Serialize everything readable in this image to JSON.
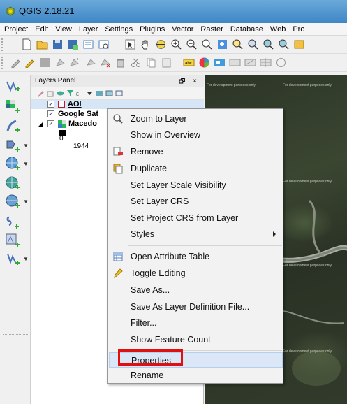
{
  "window": {
    "title": "QGIS 2.18.21"
  },
  "menubar": {
    "items": [
      "Project",
      "Edit",
      "View",
      "Layer",
      "Settings",
      "Plugins",
      "Vector",
      "Raster",
      "Database",
      "Web",
      "Pro"
    ]
  },
  "layers_panel": {
    "title": "Layers Panel",
    "controls": "🗗 ×",
    "layers": [
      {
        "name": "AOI",
        "checked": true
      },
      {
        "name": "Google Sat",
        "checked": true
      },
      {
        "name": "Macedo",
        "checked": true
      }
    ],
    "legend": {
      "value_a": "0",
      "value_b": "1944"
    }
  },
  "map": {
    "watermark": "For development purposes only"
  },
  "context_menu": {
    "items": [
      {
        "label": "Zoom to Layer",
        "icon": "zoom-icon"
      },
      {
        "label": "Show in Overview",
        "icon": ""
      },
      {
        "label": "Remove",
        "icon": "remove-layer-icon"
      },
      {
        "label": "Duplicate",
        "icon": "duplicate-icon"
      },
      {
        "label": "Set Layer Scale Visibility",
        "icon": ""
      },
      {
        "label": "Set Layer CRS",
        "icon": ""
      },
      {
        "label": "Set Project CRS from Layer",
        "icon": ""
      },
      {
        "label": "Styles",
        "icon": "",
        "submenu": true
      },
      {
        "label": "Open Attribute Table",
        "icon": "table-icon"
      },
      {
        "label": "Toggle Editing",
        "icon": "pencil-icon"
      },
      {
        "label": "Save As...",
        "icon": ""
      },
      {
        "label": "Save As Layer Definition File...",
        "icon": ""
      },
      {
        "label": "Filter...",
        "icon": ""
      },
      {
        "label": "Show Feature Count",
        "icon": ""
      },
      {
        "label": "Properties",
        "icon": "",
        "highlighted": true
      },
      {
        "label": "Rename",
        "icon": ""
      }
    ]
  },
  "colors": {
    "highlight_box": "#e01010",
    "title_bar": "#3f86c6",
    "hover": "#dbe7f6"
  }
}
